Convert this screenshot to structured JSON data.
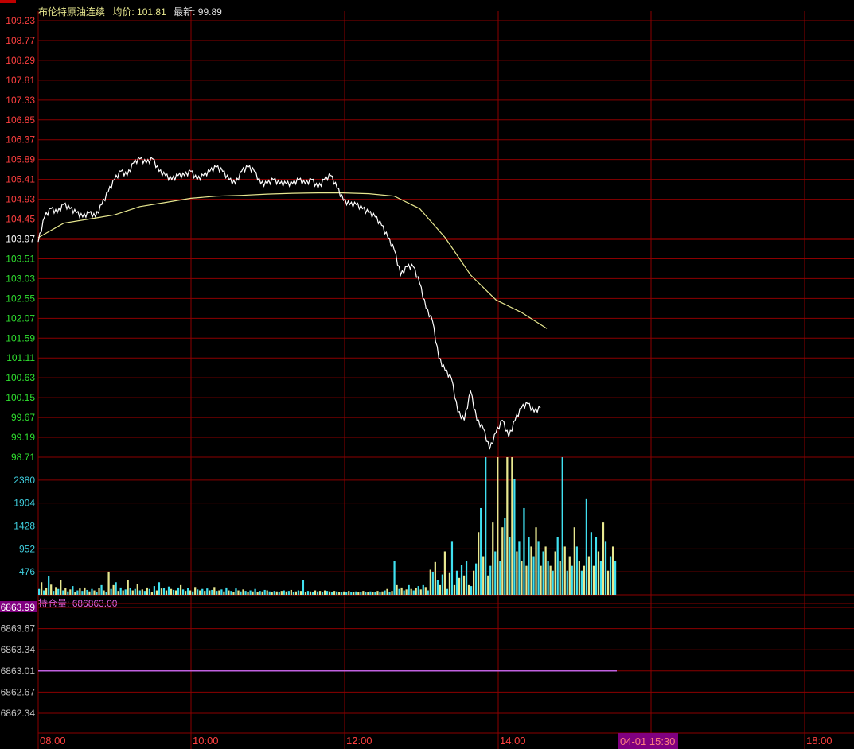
{
  "header": {
    "name": "布伦特原油连续",
    "avg_label": "均价:",
    "avg_value": "101.81",
    "last_label": "最新:",
    "last_value": "99.89"
  },
  "oi_header": {
    "label": "持仓量:",
    "value": "686863.00"
  },
  "colors": {
    "grid": "#8b0000",
    "prev_close_line": "#c00000",
    "up_text": "#ff4040",
    "down_text": "#30e030",
    "price_line": "#ffffff",
    "avg_line": "#e8e890",
    "volume_cyan": "#40e0f0",
    "volume_yellow": "#e8e890",
    "oi_line": "#c060e0",
    "time_text": "#ff4040"
  },
  "chart_data": [
    {
      "type": "line",
      "name": "price-panel",
      "x_ticks": [
        "08:00",
        "10:00",
        "12:00",
        "14:00",
        "18:00"
      ],
      "cursor_time_label": "04-01 15:30",
      "y_ticks": [
        "109.23",
        "108.77",
        "108.29",
        "107.81",
        "107.33",
        "106.85",
        "106.37",
        "105.89",
        "105.41",
        "104.93",
        "104.45",
        "103.97",
        "103.51",
        "103.03",
        "102.55",
        "102.07",
        "101.59",
        "101.11",
        "100.63",
        "100.15",
        "99.67",
        "99.19",
        "98.71"
      ],
      "ylim": [
        98.71,
        109.23
      ],
      "prev_close": 103.97,
      "series": [
        {
          "key": "price",
          "x": [
            0,
            5,
            10,
            15,
            20,
            25,
            30,
            35,
            40,
            45,
            50,
            55,
            60,
            65,
            70,
            75,
            80,
            85,
            90,
            95,
            100,
            105,
            110,
            115,
            120,
            125,
            130,
            135,
            140,
            145,
            150,
            155,
            160,
            165,
            170,
            175,
            180,
            185,
            190,
            195,
            200,
            205,
            210,
            215,
            220,
            225,
            230,
            235,
            240,
            245,
            250,
            255,
            260,
            265,
            270,
            275,
            280,
            285,
            290,
            295,
            300,
            305,
            310,
            315,
            320,
            325,
            330,
            335,
            340,
            345,
            350,
            355,
            360,
            365,
            370,
            375,
            380,
            385,
            390,
            395,
            400,
            405,
            410,
            415,
            420,
            425,
            430,
            435,
            440,
            445,
            450,
            455
          ],
          "values": [
            103.9,
            104.5,
            104.7,
            104.6,
            104.8,
            104.7,
            104.6,
            104.5,
            104.6,
            104.5,
            104.8,
            105.1,
            105.4,
            105.6,
            105.5,
            105.8,
            105.9,
            105.8,
            105.9,
            105.6,
            105.5,
            105.4,
            105.5,
            105.5,
            105.6,
            105.4,
            105.5,
            105.6,
            105.7,
            105.6,
            105.4,
            105.3,
            105.6,
            105.7,
            105.6,
            105.3,
            105.3,
            105.4,
            105.3,
            105.3,
            105.3,
            105.4,
            105.3,
            105.4,
            105.2,
            105.4,
            105.5,
            105.2,
            104.9,
            104.8,
            104.8,
            104.7,
            104.6,
            104.5,
            104.3,
            104.0,
            103.7,
            103.1,
            103.3,
            103.3,
            102.9,
            102.3,
            102.0,
            101.1,
            100.8,
            100.6,
            99.8,
            99.6,
            100.3,
            99.6,
            99.4,
            98.9,
            99.3,
            99.6,
            99.2,
            99.6,
            99.9,
            100.0,
            99.8,
            99.9,
            99.9,
            99.9,
            99.9,
            99.9,
            99.9,
            99.9,
            99.9,
            99.9,
            99.9,
            99.9,
            99.9,
            99.89
          ],
          "visible_count": 80
        },
        {
          "key": "avg",
          "x": [
            0,
            20,
            40,
            60,
            80,
            100,
            120,
            140,
            160,
            180,
            200,
            220,
            240,
            260,
            280,
            300,
            320,
            340,
            360,
            380,
            400
          ],
          "values": [
            104.0,
            104.35,
            104.45,
            104.55,
            104.75,
            104.85,
            104.95,
            105.0,
            105.02,
            105.05,
            105.07,
            105.08,
            105.08,
            105.06,
            105.0,
            104.7,
            104.0,
            103.1,
            102.5,
            102.2,
            101.81
          ],
          "visible_count": 21
        }
      ],
      "x_domain_minutes": [
        0,
        600
      ]
    },
    {
      "type": "bar",
      "name": "volume-panel",
      "y_ticks": [
        "2380",
        "1904",
        "1428",
        "952",
        "476"
      ],
      "ylim": [
        0,
        2856
      ],
      "bars": [
        120,
        260,
        90,
        140,
        380,
        210,
        80,
        160,
        120,
        300,
        90,
        140,
        70,
        110,
        180,
        60,
        90,
        130,
        80,
        150,
        100,
        70,
        120,
        90,
        60,
        140,
        200,
        90,
        60,
        480,
        120,
        200,
        260,
        80,
        150,
        90,
        110,
        300,
        140,
        90,
        120,
        220,
        90,
        110,
        80,
        150,
        120,
        60,
        180,
        90,
        260,
        130,
        140,
        90,
        170,
        120,
        100,
        90,
        150,
        200,
        110,
        80,
        140,
        90,
        70,
        160,
        110,
        90,
        120,
        80,
        130,
        90,
        100,
        160,
        80,
        90,
        110,
        70,
        150,
        90,
        80,
        60,
        130,
        90,
        70,
        110,
        80,
        60,
        90,
        70,
        120,
        60,
        80,
        70,
        100,
        90,
        70,
        60,
        80,
        70,
        60,
        80,
        90,
        70,
        80,
        100,
        60,
        70,
        90,
        80,
        300,
        60,
        80,
        70,
        60,
        90,
        70,
        80,
        60,
        90,
        80,
        70,
        60,
        80,
        70,
        60,
        50,
        70,
        60,
        80,
        50,
        60,
        70,
        50,
        60,
        80,
        60,
        50,
        70,
        60,
        50,
        80,
        60,
        70,
        90,
        120,
        60,
        80,
        700,
        200,
        120,
        150,
        90,
        110,
        200,
        120,
        90,
        140,
        180,
        110,
        200,
        160,
        90,
        520,
        480,
        680,
        300,
        200,
        420,
        900,
        120,
        450,
        1100,
        200,
        500,
        350,
        620,
        400,
        700,
        200,
        180,
        500,
        650,
        1300,
        1800,
        800,
        2856,
        400,
        600,
        1500,
        900,
        2856,
        700,
        1400,
        1600,
        2856,
        1200,
        2856,
        2400,
        900,
        1100,
        700,
        1800,
        600,
        1200,
        1000,
        800,
        1400,
        1100,
        600,
        900,
        1000,
        700,
        600,
        500,
        900,
        1200,
        700,
        2856,
        1000,
        500,
        800,
        600,
        1400,
        1000,
        700,
        500,
        600,
        2000,
        800,
        1300,
        600,
        1200,
        900,
        700,
        1500,
        1100,
        500,
        800,
        1000,
        700
      ],
      "bar_colors_pattern": "alternating cyan/yellow"
    },
    {
      "type": "line",
      "name": "open-interest-panel",
      "y_ticks": [
        "6863.99",
        "6863.67",
        "6863.34",
        "6863.01",
        "6862.67",
        "6862.34"
      ],
      "ylim": [
        6862.1,
        6863.99
      ],
      "values": [
        6863.01,
        6863.01
      ]
    }
  ]
}
